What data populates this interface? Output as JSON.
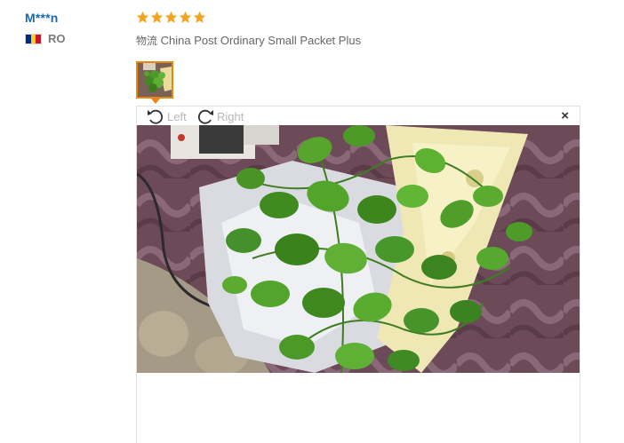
{
  "reviewer": {
    "name": "M***n",
    "country_code": "RO",
    "flag_colors": [
      "#002b7f",
      "#fcd116",
      "#ce1126"
    ]
  },
  "review": {
    "rating": 5,
    "max_rating": 5,
    "star_color": "#f7a21b",
    "logistics_label": "物流",
    "logistics_value": "China Post Ordinary Small Packet Plus"
  },
  "viewer": {
    "rotate_left_label": "Left",
    "rotate_right_label": "Right",
    "close_label": "×",
    "accent_color": "#e8860f"
  }
}
